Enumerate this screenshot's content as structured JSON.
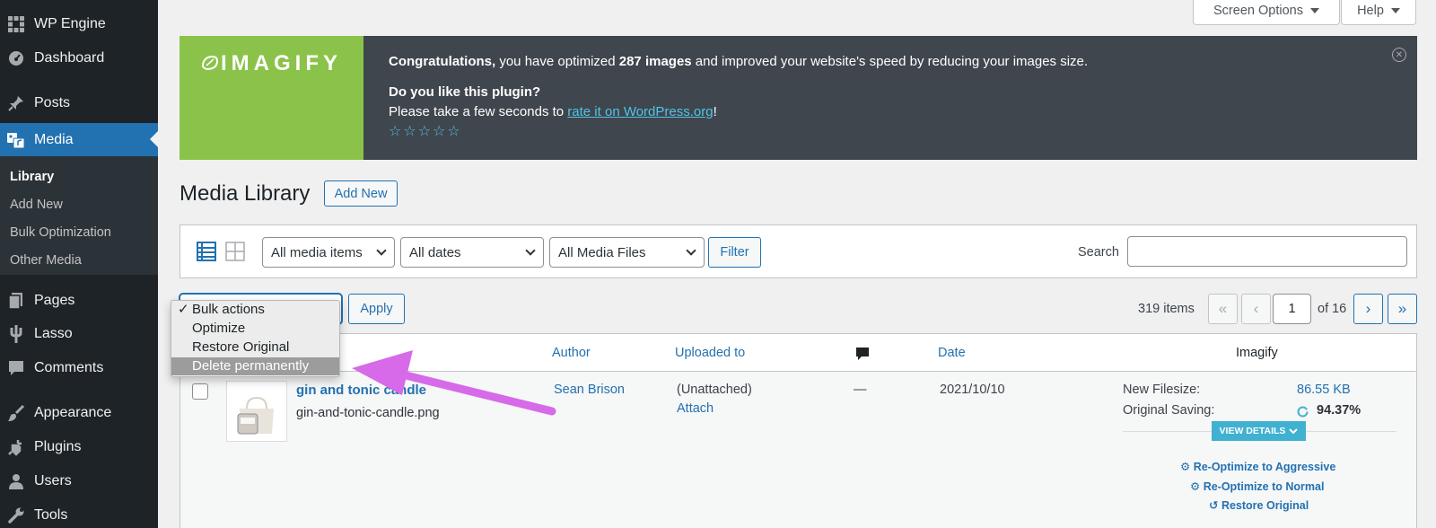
{
  "sidebar": {
    "items": [
      {
        "label": "WP Engine",
        "icon": "wpengine-icon"
      },
      {
        "label": "Dashboard",
        "icon": "dashboard-icon"
      },
      {
        "label": "Posts",
        "icon": "pin-icon"
      },
      {
        "label": "Media",
        "icon": "media-icon"
      },
      {
        "label": "Pages",
        "icon": "pages-icon"
      },
      {
        "label": "Lasso",
        "icon": "lasso-icon"
      },
      {
        "label": "Comments",
        "icon": "comments-icon"
      },
      {
        "label": "Appearance",
        "icon": "brush-icon"
      },
      {
        "label": "Plugins",
        "icon": "plugin-icon"
      },
      {
        "label": "Users",
        "icon": "user-icon"
      },
      {
        "label": "Tools",
        "icon": "wrench-icon"
      }
    ],
    "submenu": [
      "Library",
      "Add New",
      "Bulk Optimization",
      "Other Media"
    ]
  },
  "top_buttons": {
    "screen_options": "Screen Options",
    "help": "Help"
  },
  "banner": {
    "logo": "IMAGIFY",
    "congrats_bold": "Congratulations,",
    "congrats_a": " you have optimized ",
    "count": "287 images",
    "congrats_b": " and improved your website's speed by reducing your images size.",
    "question": "Do you like this plugin?",
    "rate_prefix": "Please take a few seconds to ",
    "rate_link": "rate it on WordPress.org",
    "rate_suffix": "!",
    "stars": "☆☆☆☆☆",
    "accent": "#8bc34a"
  },
  "page": {
    "title": "Media Library",
    "add_new": "Add New"
  },
  "filters": {
    "media_items": "All media items",
    "dates": "All dates",
    "media_files": "All Media Files",
    "filter_button": "Filter",
    "search_label": "Search"
  },
  "bulk": {
    "apply": "Apply"
  },
  "dropdown": {
    "check": "✓",
    "options": [
      "Bulk actions",
      "Optimize",
      "Restore Original",
      "Delete permanently"
    ]
  },
  "pagination": {
    "items": "319 items",
    "current": "1",
    "of": "of 16",
    "first": "«",
    "prev": "‹",
    "next": "›",
    "last": "»"
  },
  "table": {
    "headers": {
      "author": "Author",
      "uploaded_to": "Uploaded to",
      "date": "Date",
      "imagify": "Imagify"
    },
    "row": {
      "title": "gin and tonic candle",
      "filename": "gin-and-tonic-candle.png",
      "author": "Sean Brison",
      "uploaded_to": "(Unattached)",
      "attach": "Attach",
      "comments": "—",
      "date": "2021/10/10",
      "new_filesize_label": "New Filesize:",
      "new_filesize": "86.55 KB",
      "saving_label": "Original Saving:",
      "saving": "94.37%",
      "view_details": "VIEW DETAILS",
      "actions": [
        "Re-Optimize to Aggressive",
        "Re-Optimize to Normal",
        "Restore Original"
      ]
    }
  }
}
